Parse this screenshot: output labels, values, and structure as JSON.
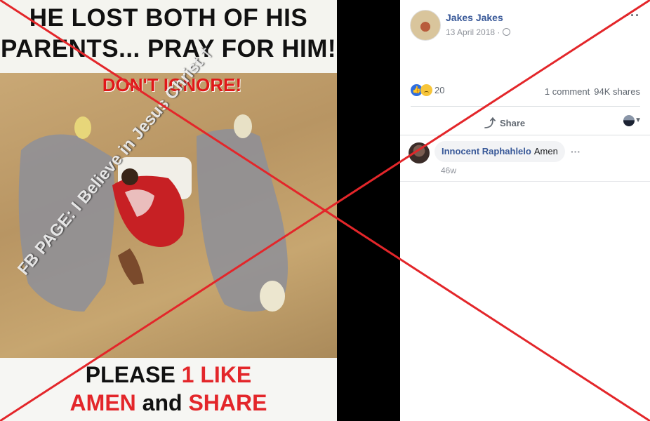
{
  "image": {
    "headline_line1": "HE LOST BOTH OF HIS",
    "headline_line2": "PARENTS... PRAY FOR HIM!",
    "warning": "DON'T IGNORE!",
    "watermark": "FB PAGE: I Believe in Jesus Christ †",
    "cta_line1_a": "PLEASE ",
    "cta_line1_b": "1 LIKE",
    "cta_line2_a": "AMEN",
    "cta_line2_b": " and ",
    "cta_line2_c": "SHARE"
  },
  "post": {
    "author": "Jakes Jakes",
    "date": "13 April 2018 ·",
    "more": "···",
    "reaction_count": "20",
    "comments": "1 comment",
    "shares": "94K shares",
    "share_label": "Share"
  },
  "comment": {
    "name": "Innocent Raphahlelo",
    "text": "Amen",
    "time": "46w",
    "more": "···"
  },
  "colors": {
    "accent_link": "#385898",
    "cross": "#e3262a"
  }
}
